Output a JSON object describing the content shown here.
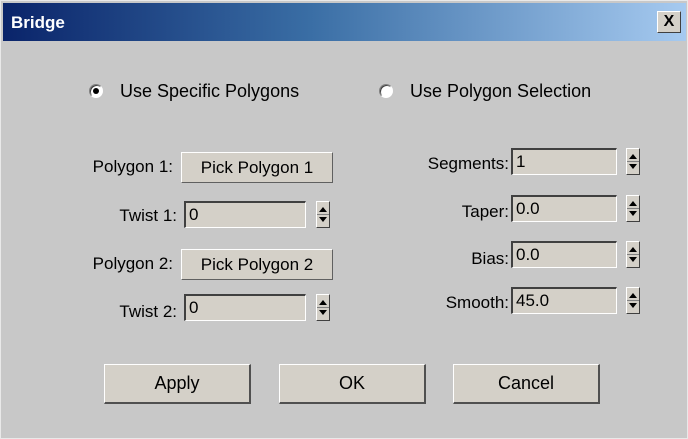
{
  "window": {
    "title": "Bridge",
    "close_glyph": "X"
  },
  "radios": [
    {
      "label": "Use Specific Polygons",
      "checked": true
    },
    {
      "label": "Use Polygon Selection",
      "checked": false
    }
  ],
  "left": {
    "polygon1_label": "Polygon 1:",
    "polygon1_button": "Pick Polygon 1",
    "twist1_label": "Twist 1:",
    "twist1_value": "0",
    "polygon2_label": "Polygon 2:",
    "polygon2_button": "Pick Polygon 2",
    "twist2_label": "Twist 2:",
    "twist2_value": "0"
  },
  "right": {
    "segments_label": "Segments:",
    "segments_value": "1",
    "taper_label": "Taper:",
    "taper_value": "0.0",
    "bias_label": "Bias:",
    "bias_value": "0.0",
    "smooth_label": "Smooth:",
    "smooth_value": "45.0"
  },
  "buttons": {
    "apply": "Apply",
    "ok": "OK",
    "cancel": "Cancel"
  },
  "colors": {
    "dialog_bg": "#c8c8c8",
    "title_start": "#0a246a",
    "title_end": "#a6caf0"
  }
}
